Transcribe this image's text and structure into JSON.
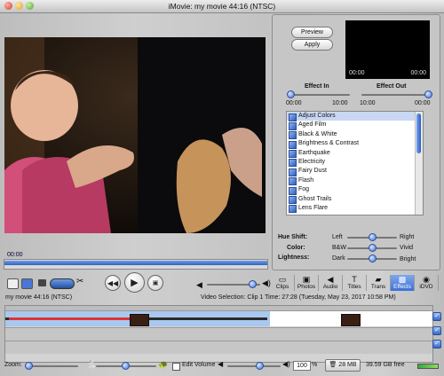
{
  "window": {
    "title": "iMovie: my movie  44:16 (NTSC)"
  },
  "monitor": {
    "scrub_time": "00:00"
  },
  "panel": {
    "preview_label": "Preview",
    "apply_label": "Apply",
    "preview_time_start": "00:00",
    "preview_time_end": "00:00",
    "effect_in": {
      "label": "Effect In",
      "min": "00:00",
      "max": "10:00",
      "value_fraction": 0.0
    },
    "effect_out": {
      "label": "Effect Out",
      "min": "10:00",
      "max": "00:00",
      "value_fraction": 1.0
    },
    "effects": [
      "Adjust Colors",
      "Aged Film",
      "Black & White",
      "Brightness & Contrast",
      "Earthquake",
      "Electricity",
      "Fairy Dust",
      "Flash",
      "Fog",
      "Ghost Trails",
      "Lens Flare"
    ],
    "selected_effect": "Adjust Colors",
    "hue_shift": {
      "label": "Hue Shift:",
      "left": "Left",
      "right": "Right",
      "value_fraction": 0.5
    },
    "color": {
      "label": "Color:",
      "left": "B&W",
      "right": "Vivid",
      "value_fraction": 0.5
    },
    "lightness": {
      "label": "Lightness:",
      "left": "Dark",
      "right": "Bright",
      "value_fraction": 0.5
    }
  },
  "tabs": [
    {
      "label": "Clips",
      "icon": "clips-icon",
      "glyph": "▭"
    },
    {
      "label": "Photos",
      "icon": "photos-icon",
      "glyph": "▣"
    },
    {
      "label": "Audio",
      "icon": "audio-icon",
      "glyph": "◀"
    },
    {
      "label": "Titles",
      "icon": "titles-icon",
      "glyph": "T"
    },
    {
      "label": "Trans",
      "icon": "transitions-icon",
      "glyph": "▰"
    },
    {
      "label": "Effects",
      "icon": "effects-icon",
      "glyph": "▩"
    },
    {
      "label": "iDVD",
      "icon": "idvd-icon",
      "glyph": "◉"
    }
  ],
  "selected_tab": "Effects",
  "status": {
    "movie_info": "my movie  44:16 (NTSC)",
    "selection_info": "Video Selection: Clip 1 Time: 27:28 (Tuesday, May 23, 2017 10:58 PM)"
  },
  "bottom": {
    "zoom_label": "Zoom:",
    "edit_volume_label": "Edit Volume",
    "volume_value": "100",
    "percent": "%",
    "disk_button": "28 MB",
    "free_space": "39.59 GB free"
  },
  "colors": {
    "accent": "#3d6fd4",
    "selection": "#c9d8f2",
    "track_bg": "#a9c8ef"
  }
}
